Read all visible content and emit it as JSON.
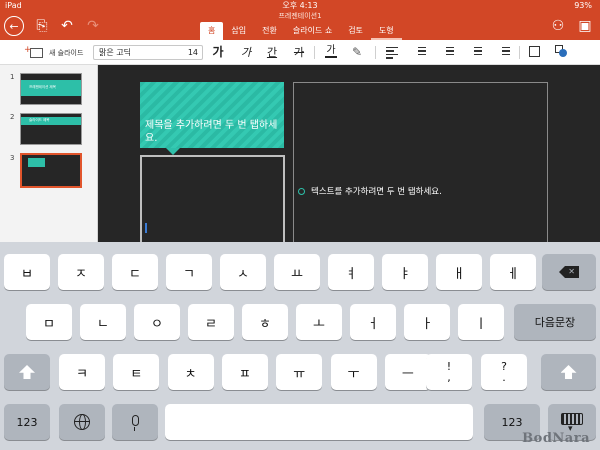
{
  "status_bar": {
    "device": "iPad",
    "time": "오후 4:13",
    "battery": "93%"
  },
  "document": {
    "title": "프레젠테이션1"
  },
  "ribbon": {
    "tabs": [
      {
        "label": "홈",
        "active": true
      },
      {
        "label": "삽입"
      },
      {
        "label": "전환"
      },
      {
        "label": "슬라이드 쇼"
      },
      {
        "label": "검토"
      },
      {
        "label": "도형",
        "contextual": true
      }
    ]
  },
  "toolbar": {
    "new_slide_label": "새 슬라이드",
    "font_name": "맑은 고딕",
    "font_size": "14",
    "bold_label": "가",
    "italic_label": "가",
    "underline_label": "간",
    "strike_label": "가",
    "font_color_label": "가"
  },
  "thumbnails": [
    {
      "number": "1",
      "title": "프레젠테이션 제목"
    },
    {
      "number": "2",
      "title": "슬라이드 제목"
    },
    {
      "number": "3",
      "selected": true
    }
  ],
  "slide": {
    "title_placeholder": "제목을 추가하려면 두 번 탭하세요.",
    "body_placeholder": "텍스트를 추가하려면 두 번 탭하세요."
  },
  "keyboard": {
    "row1": [
      "ㅂ",
      "ㅈ",
      "ㄷ",
      "ㄱ",
      "ㅅ",
      "ㅛ",
      "ㅕ",
      "ㅑ",
      "ㅐ",
      "ㅔ"
    ],
    "row2": [
      "ㅁ",
      "ㄴ",
      "ㅇ",
      "ㄹ",
      "ㅎ",
      "ㅗ",
      "ㅓ",
      "ㅏ",
      "ㅣ"
    ],
    "return_label": "다음문장",
    "row3": [
      "ㅋ",
      "ㅌ",
      "ㅊ",
      "ㅍ",
      "ㅠ",
      "ㅜ",
      "ㅡ"
    ],
    "punct1": [
      "!",
      ","
    ],
    "punct2": [
      "?",
      "."
    ],
    "numbers_label": "123"
  },
  "watermark": "BodNara",
  "colors": {
    "accent": "#d24726",
    "teal": "#2dbfa8",
    "slide_bg": "#262626"
  },
  "icons": [
    "back-icon",
    "open-file-icon",
    "undo-icon",
    "redo-icon",
    "share-icon",
    "present-icon"
  ]
}
